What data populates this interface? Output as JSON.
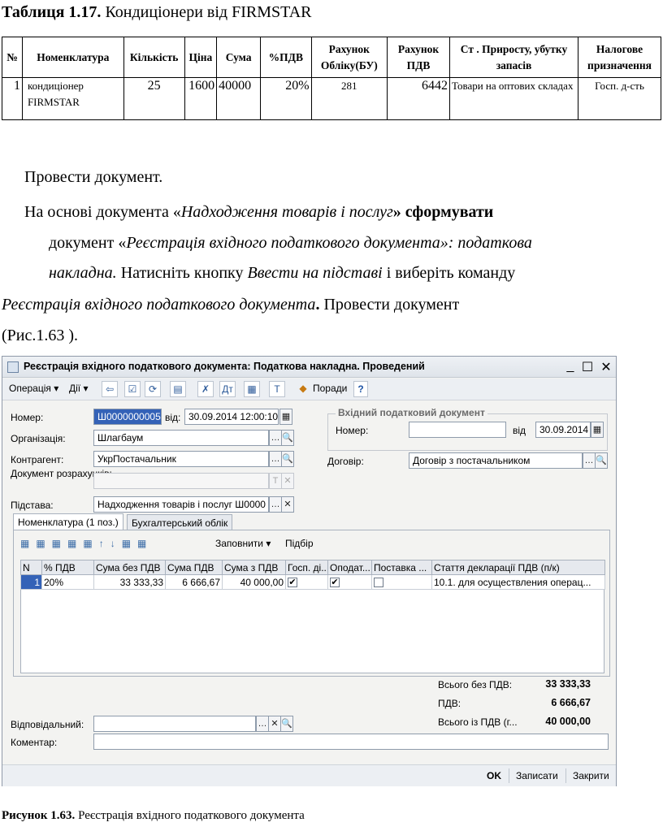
{
  "table_caption": {
    "bold": "Таблиця 1.17.",
    "rest": " Кондиціонери від FIRMSTAR"
  },
  "doc_table": {
    "headers": [
      "№",
      "Номенклатура",
      "Кількість",
      "Ціна",
      "Сума",
      "%ПДВ",
      "Рахунок Обліку(БУ)",
      "Рахунок ПДВ",
      "Ст . Приросту, убутку запасів",
      "Налогове призначення"
    ],
    "rows": [
      [
        "1",
        "кондиціонер FIRMSTAR",
        "25",
        "1600",
        "40000",
        "20%",
        "281",
        "6442",
        "Товари на оптових складах",
        "Госп. д-сть"
      ]
    ]
  },
  "text": {
    "p1": "Провести документ.",
    "p2_a": "На   основі   документа   «",
    "p2_b": "Надходження   товарів   і   послуг",
    "p2_c": "»   сформувати",
    "p3_a": "документ  «",
    "p3_b": "Реєстрація  вхідного  податкового  документа»:  податкова",
    "p4_a": "накладна.",
    "p4_b": " Натисніть кнопку ",
    "p4_c": "Ввести на підставі",
    "p4_d": " і виберіть команду",
    "p5_a": "Реєстрація   вхідного   податкового   документа",
    "p5_b": ".",
    "p5_c": "  Провести  документ",
    "p6": "(Рис.1.63 )."
  },
  "window": {
    "title": "Реєстрація вхідного податкового документа: Податкова накладна. Проведений",
    "controls": {
      "minimize": "_",
      "maximize": "☐",
      "close": "✕"
    },
    "toolbar": {
      "operation": "Операція ▾",
      "actions": "Дії ▾",
      "tips": "Поради",
      "help": "?"
    },
    "labels": {
      "number": "Номер:",
      "from": "від:",
      "organization": "Організація:",
      "counterparty": "Контрагент:",
      "settlement_doc": "Документ розрахунків:",
      "basis": "Підстава:",
      "incoming_group": "Вхідний податковий документ",
      "inc_number": "Номер:",
      "inc_date": "від",
      "contract": "Договір:",
      "responsible": "Відповідальний:",
      "comment": "Коментар:"
    },
    "values": {
      "number": "Ш0000000005",
      "date": "30.09.2014 12:00:10",
      "organization": "Шлагбаум",
      "counterparty": "УкрПостачальник",
      "settlement_doc": "",
      "basis": "Надходження товарів і послуг Ш0000",
      "inc_number": "",
      "inc_date": "30.09.2014",
      "contract": "Договір з постачальником",
      "responsible": "",
      "comment": ""
    },
    "tabs": [
      "Номенклатура (1 поз.)",
      "Бухгалтерський облік"
    ],
    "grid_toolbar": {
      "fill": "Заповнити ▾",
      "select": "Підбір"
    },
    "grid": {
      "columns": [
        "N",
        "% ПДВ",
        "Сума без ПДВ",
        "Сума ПДВ",
        "Сума з ПДВ",
        "Госп. ді...",
        "Оподат...",
        "Поставка ...",
        "Стаття декларації ПДВ (п/к)"
      ],
      "rows": [
        {
          "n": "1",
          "vat": "20%",
          "sum_no_vat": "33 333,33",
          "sum_vat": "6 666,67",
          "sum_with_vat": "40 000,00",
          "business": "✔",
          "taxable": "✔",
          "supply": "",
          "article": "10.1. для осуществления операц..."
        }
      ]
    },
    "totals": {
      "no_vat_label": "Всього без ПДВ:",
      "no_vat": "33 333,33",
      "vat_label": "ПДВ:",
      "vat": "6 666,67",
      "with_vat_label": "Всього із ПДВ (г...",
      "with_vat": "40 000,00"
    },
    "footer": {
      "ok": "OK",
      "save": "Записати",
      "close": "Закрити"
    }
  },
  "figure_caption": {
    "bold": "Рисунок 1.63.",
    "rest": " Реєстрація вхідного податкового документа"
  }
}
